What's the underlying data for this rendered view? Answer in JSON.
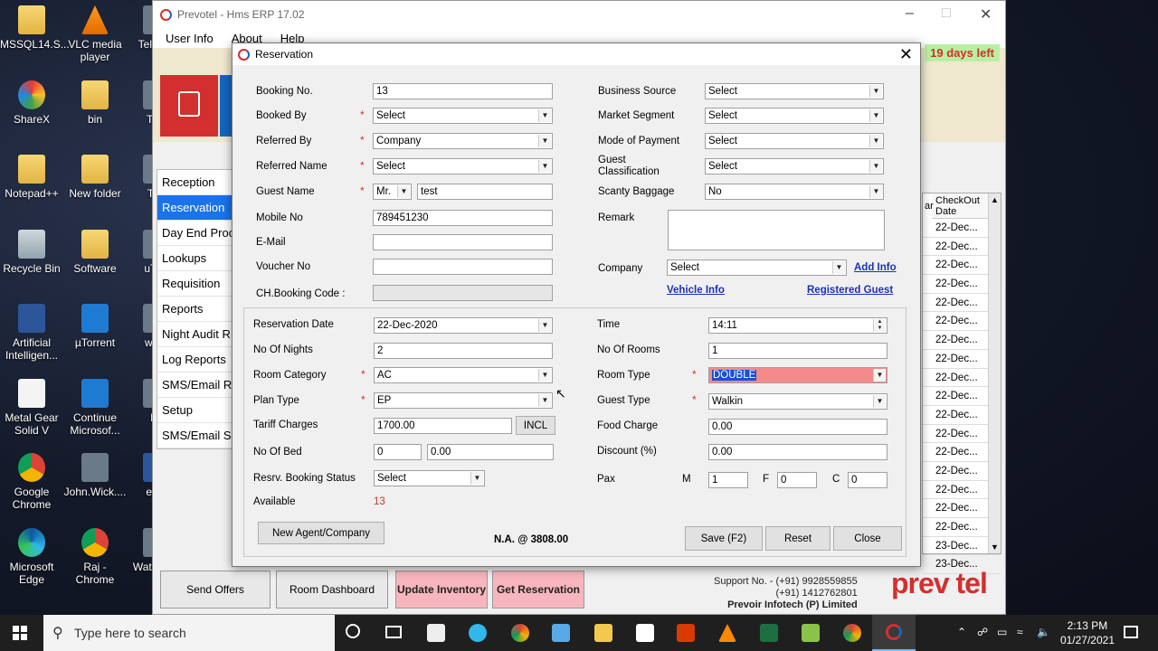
{
  "desktop_icons": [
    {
      "label": "MSSQL14.S...",
      "type": "folder"
    },
    {
      "label": "VLC media player",
      "type": "vlc"
    },
    {
      "label": "Tele De",
      "type": "gray"
    },
    {
      "label": "ShareX",
      "type": "sharex"
    },
    {
      "label": "bin",
      "type": "folder"
    },
    {
      "label": "Tele",
      "type": "gray"
    },
    {
      "label": "Notepad++",
      "type": "folder"
    },
    {
      "label": "New folder",
      "type": "folder"
    },
    {
      "label": "Turi",
      "type": "gray"
    },
    {
      "label": "Recycle Bin",
      "type": "recycle"
    },
    {
      "label": "Software",
      "type": "folder"
    },
    {
      "label": "uTorr",
      "type": "gray"
    },
    {
      "label": "Artificial Intelligen...",
      "type": "word"
    },
    {
      "label": "µTorrent",
      "type": "utorrent"
    },
    {
      "label": "www",
      "type": "gray"
    },
    {
      "label": "Metal Gear Solid V",
      "type": "file"
    },
    {
      "label": "Continue Microsof...",
      "type": "utorrent"
    },
    {
      "label": "bu",
      "type": "gray"
    },
    {
      "label": "Google Chrome",
      "type": "chrome"
    },
    {
      "label": "John.Wick....",
      "type": "gray"
    },
    {
      "label": "e-co",
      "type": "word"
    },
    {
      "label": "Microsoft Edge",
      "type": "edge"
    },
    {
      "label": "Raj - Chrome",
      "type": "chrome"
    },
    {
      "label": "Watc - Sh",
      "type": "gray"
    }
  ],
  "app": {
    "title": "Prevotel - Hms ERP 17.02",
    "menu": [
      "User Info",
      "About",
      "Help"
    ],
    "trial": "19 days left",
    "nav": [
      "Reception",
      "Reservation",
      "Day End Proc",
      "Lookups",
      "Requisition",
      "Reports",
      "Night Audit R",
      "Log Reports",
      "SMS/Email Re",
      "Setup",
      "SMS/Email Se"
    ],
    "grid_header": "CheckOut Date",
    "grid_partial_header": "ar",
    "grid_rows": [
      "22-Dec...",
      "22-Dec...",
      "22-Dec...",
      "22-Dec...",
      "22-Dec...",
      "22-Dec...",
      "22-Dec...",
      "22-Dec...",
      "22-Dec...",
      "22-Dec...",
      "22-Dec...",
      "22-Dec...",
      "22-Dec...",
      "22-Dec...",
      "22-Dec...",
      "22-Dec...",
      "22-Dec...",
      "23-Dec...",
      "23-Dec..."
    ],
    "bottom_buttons": [
      "Send Offers",
      "Room Dashboard",
      "Update Inventory",
      "Get Reservation"
    ],
    "support_lines": [
      "Support No. - (+91) 9928559855",
      "(+91) 1412762801",
      "Prevoir Infotech (P) Limited"
    ],
    "brand": "prev tel"
  },
  "dialog": {
    "title": "Reservation",
    "booking_no": {
      "label": "Booking No.",
      "value": "13"
    },
    "booked_by": {
      "label": "Booked By",
      "value": "Select"
    },
    "referred_by": {
      "label": "Referred By",
      "value": "Company"
    },
    "referred_name": {
      "label": "Referred Name",
      "value": "Select"
    },
    "guest_name": {
      "label": "Guest Name",
      "title": "Mr.",
      "value": "test"
    },
    "mobile_no": {
      "label": "Mobile No",
      "value": "789451230"
    },
    "email": {
      "label": "E-Mail",
      "value": ""
    },
    "voucher_no": {
      "label": "Voucher No",
      "value": ""
    },
    "ch_booking": {
      "label": "CH.Booking Code :",
      "value": ""
    },
    "business_source": {
      "label": "Business Source",
      "value": "Select"
    },
    "market_segment": {
      "label": "Market Segment",
      "value": "Select"
    },
    "mode_of_payment": {
      "label": "Mode of Payment",
      "value": "Select"
    },
    "guest_classification": {
      "label": "Guest Classification",
      "value": "Select"
    },
    "scanty_baggage": {
      "label": "Scanty Baggage",
      "value": "No"
    },
    "remark": {
      "label": "Remark",
      "value": ""
    },
    "company": {
      "label": "Company",
      "value": "Select"
    },
    "links": {
      "add_info": "Add Info",
      "vehicle_info": "Vehicle Info",
      "registered_guest": "Registered Guest"
    },
    "reservation_date": {
      "label": "Reservation Date",
      "value": "22-Dec-2020"
    },
    "no_of_nights": {
      "label": "No Of Nights",
      "value": "2"
    },
    "room_category": {
      "label": "Room Category",
      "value": "AC"
    },
    "plan_type": {
      "label": "Plan Type",
      "value": "EP"
    },
    "tariff": {
      "label": "Tariff Charges",
      "value": "1700.00",
      "btn": "INCL"
    },
    "no_of_bed": {
      "label": "No Of Bed",
      "value1": "0",
      "value2": "0.00"
    },
    "booking_status": {
      "label": "Resrv. Booking Status",
      "value": "Select"
    },
    "available": {
      "label": "Available",
      "value": "13"
    },
    "time": {
      "label": "Time",
      "value": "14:11"
    },
    "no_of_rooms": {
      "label": "No Of Rooms",
      "value": "1"
    },
    "room_type": {
      "label": "Room Type",
      "value": "DOUBLE"
    },
    "guest_type": {
      "label": "Guest Type",
      "value": "Walkin"
    },
    "food_charge": {
      "label": "Food Charge",
      "value": "0.00"
    },
    "discount": {
      "label": "Discount (%)",
      "value": "0.00"
    },
    "pax": {
      "label": "Pax",
      "m_label": "M",
      "m": "1",
      "f_label": "F",
      "f": "0",
      "c_label": "C",
      "c": "0"
    },
    "na_text": "N.A. @ 3808.00",
    "buttons": {
      "new_agent": "New Agent/Company",
      "save": "Save (F2)",
      "reset": "Reset",
      "close": "Close"
    }
  },
  "taskbar": {
    "search_placeholder": "Type here to search",
    "time": "2:13 PM",
    "date": "01/27/2021"
  },
  "colors": {
    "accent": "#1a73e8",
    "required": "#d32f2f",
    "room_type_bg": "#f48b8b",
    "update_btn_bg": "#f7b6bd",
    "link": "#1a33b8"
  }
}
